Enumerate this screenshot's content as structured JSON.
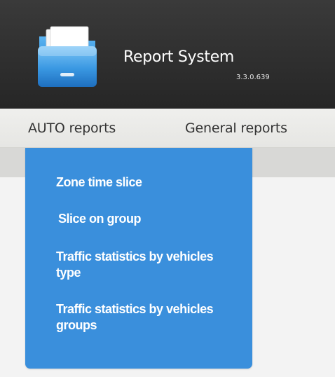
{
  "header": {
    "title": "Report System",
    "version": "3.3.0.639",
    "logo_icon": "folder-icon"
  },
  "menu": {
    "items": [
      {
        "label": "AUTO reports"
      },
      {
        "label": "General reports"
      }
    ]
  },
  "dropdown": {
    "items": [
      {
        "label": "Zone time slice"
      },
      {
        "label": "Slice on group"
      },
      {
        "label": "Traffic statistics by vehicles type"
      },
      {
        "label": "Traffic statistics by vehicles groups"
      }
    ]
  },
  "colors": {
    "header_bg": "#2f2f2f",
    "menubar_bg": "#e8e8e6",
    "dropdown_bg": "#3a8fdc",
    "dropdown_text": "#ffffff"
  }
}
